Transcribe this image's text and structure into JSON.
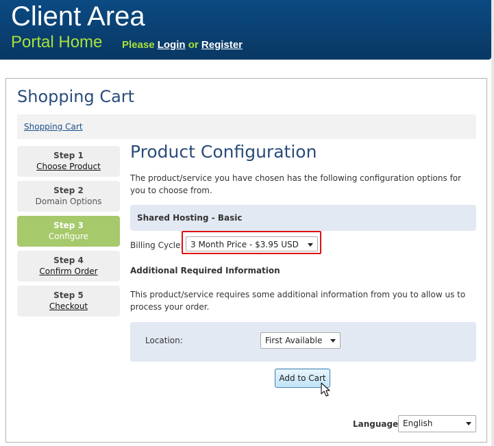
{
  "header": {
    "title": "Client Area",
    "portal_link": "Portal Home",
    "please": "Please",
    "login": "Login",
    "or": "or",
    "register": "Register"
  },
  "page": {
    "title": "Shopping Cart",
    "breadcrumb": "Shopping Cart"
  },
  "steps": [
    {
      "num": "Step 1",
      "label": "Choose Product",
      "state": "link"
    },
    {
      "num": "Step 2",
      "label": "Domain Options",
      "state": "plain"
    },
    {
      "num": "Step 3",
      "label": "Configure",
      "state": "active"
    },
    {
      "num": "Step 4",
      "label": "Confirm Order",
      "state": "link"
    },
    {
      "num": "Step 5",
      "label": "Checkout",
      "state": "link"
    }
  ],
  "config": {
    "title": "Product Configuration",
    "intro": "The product/service you have chosen has the following configuration options for you to choose from.",
    "product_name": "Shared Hosting - Basic",
    "billing_label": "Billing Cycle:",
    "billing_value": "3 Month Price - $3.95 USD",
    "additional_heading": "Additional Required Information",
    "additional_text": "This product/service requires some additional information from you to allow us to process your order.",
    "location_label": "Location:",
    "location_value": "First Available",
    "add_button": "Add to Cart"
  },
  "language": {
    "label": "Language:",
    "value": "English"
  },
  "colors": {
    "header_bg": "#0a3f70",
    "accent_green": "#a8e23b",
    "active_step": "#a6c96b",
    "title_blue": "#2a4c7a",
    "highlight_red": "#e01010"
  }
}
